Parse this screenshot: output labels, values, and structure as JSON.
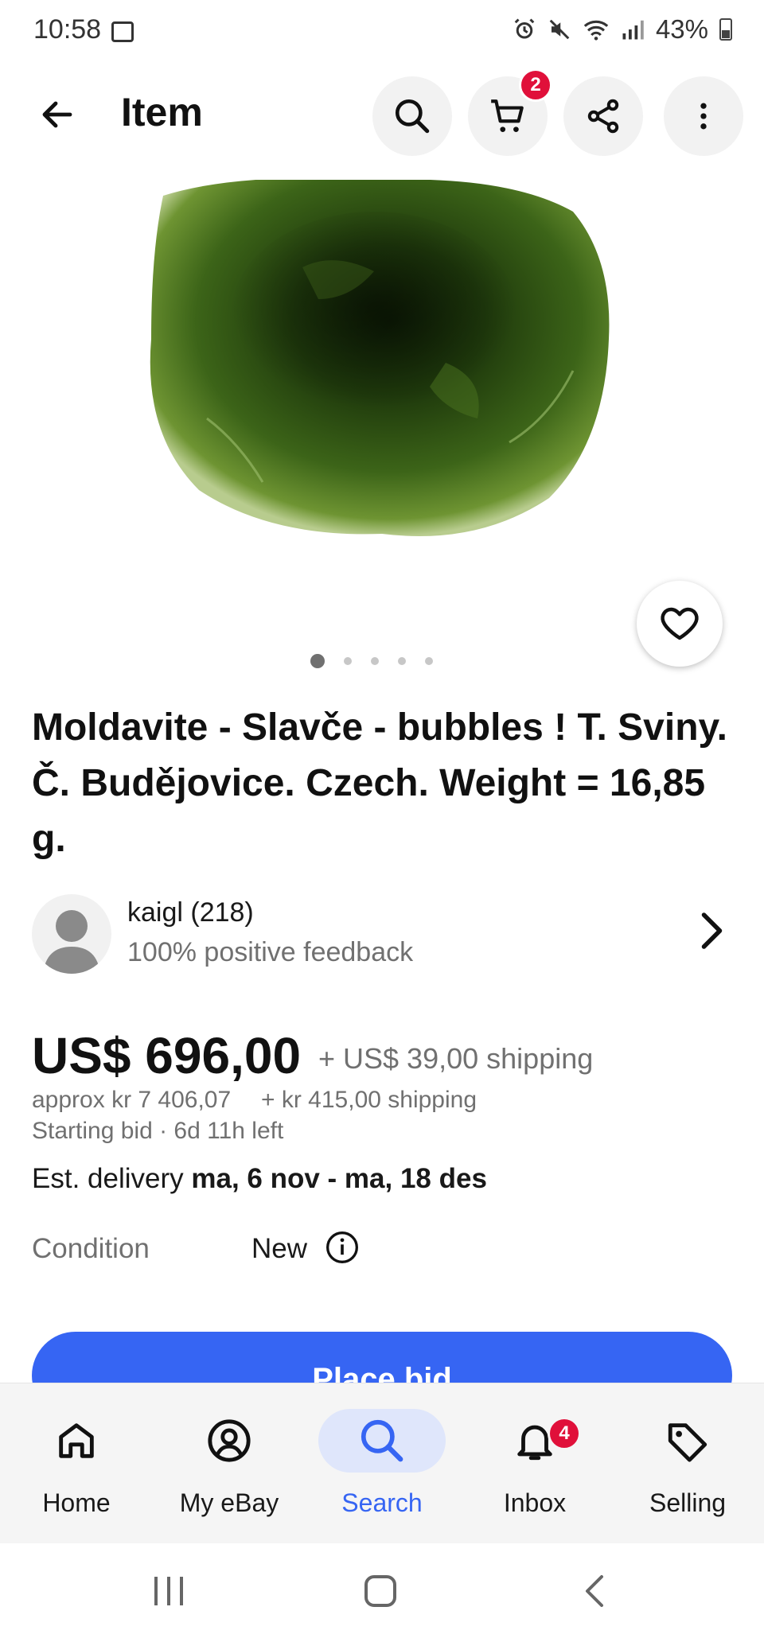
{
  "status_bar": {
    "time": "10:58",
    "battery": "43%"
  },
  "app_bar": {
    "title": "Item",
    "cart_count": "2"
  },
  "gallery": {
    "image_count": 5,
    "active_index": 0
  },
  "item": {
    "title": "Moldavite - Slavče - bubbles ! T. Sviny. Č. Budějovice. Czech. Weight = 16,85 g."
  },
  "seller": {
    "name": "kaigl (218)",
    "feedback": "100% positive feedback"
  },
  "pricing": {
    "price": "US$ 696,00",
    "shipping": "+ US$ 39,00 shipping",
    "approx": "approx kr 7 406,07",
    "approx_shipping": "+ kr 415,00 shipping",
    "bid_info": "Starting bid · 6d 11h left"
  },
  "delivery": {
    "label": "Est. delivery",
    "range": "ma, 6 nov - ma, 18 des"
  },
  "condition": {
    "label": "Condition",
    "value": "New"
  },
  "actions": {
    "place_bid": "Place bid"
  },
  "bottom_nav": {
    "home": "Home",
    "my_ebay": "My eBay",
    "search": "Search",
    "inbox": "Inbox",
    "inbox_count": "4",
    "selling": "Selling"
  },
  "colors": {
    "accent": "#3665f3",
    "badge": "#e0103a"
  }
}
